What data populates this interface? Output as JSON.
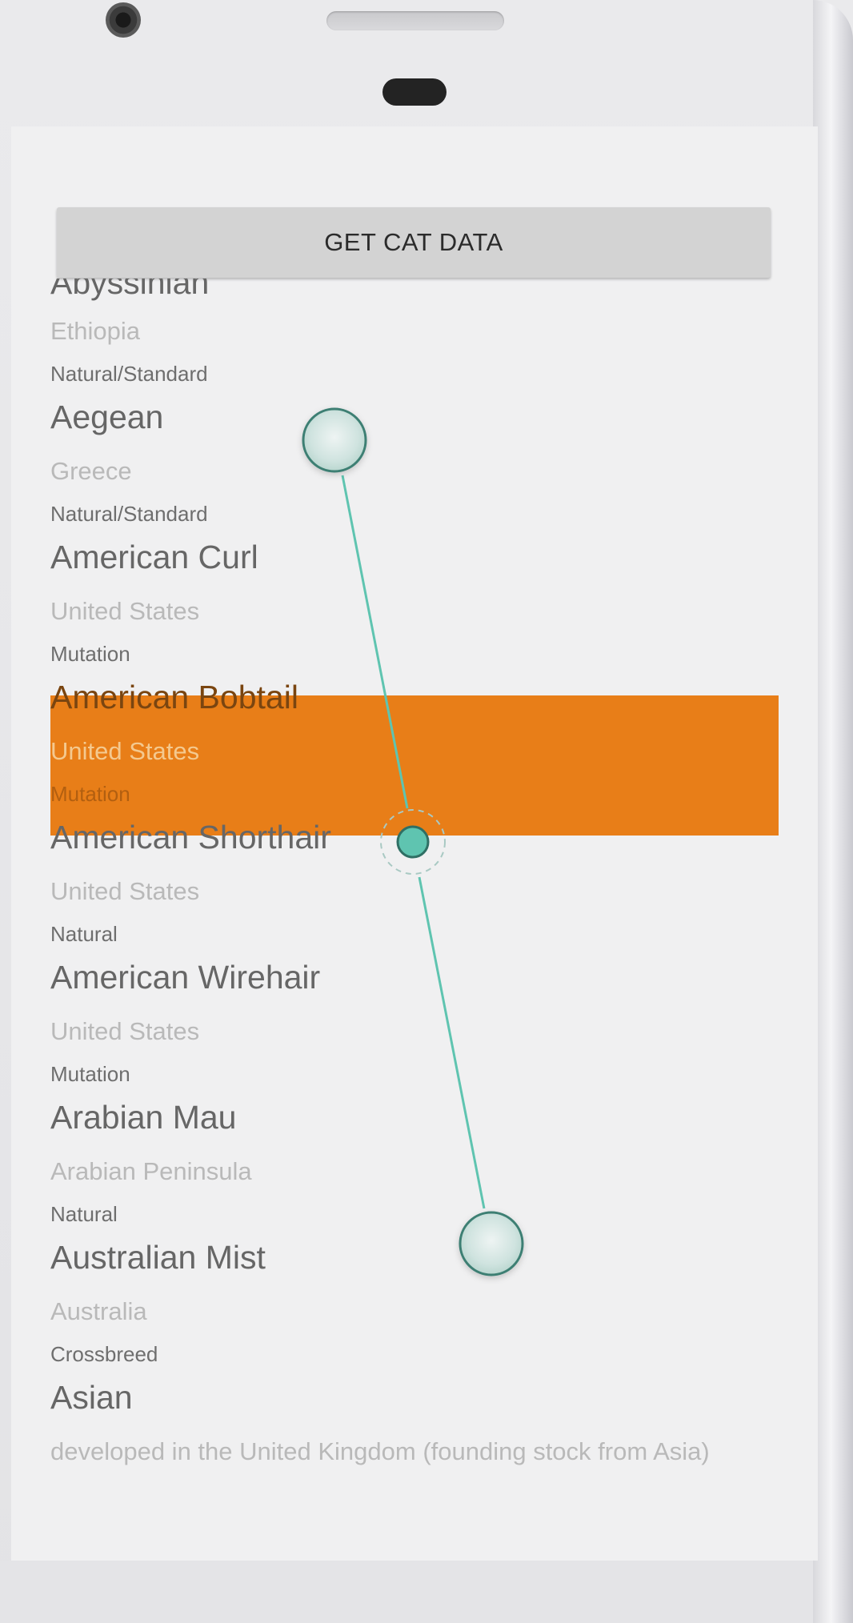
{
  "app": {
    "get_button_label": "GET CAT DATA"
  },
  "list": {
    "partial_top_name": "Abyssinian",
    "items": [
      {
        "origin": "Ethiopia",
        "type": "Natural/Standard"
      },
      {
        "name": "Aegean",
        "origin": "Greece",
        "type": "Natural/Standard"
      },
      {
        "name": "American Curl",
        "origin": "United States",
        "type": "Mutation"
      },
      {
        "name": "American Bobtail",
        "origin": "United States",
        "type": "Mutation"
      },
      {
        "name": "American Shorthair",
        "origin": "United States",
        "type": "Natural"
      },
      {
        "name": "American Wirehair",
        "origin": "United States",
        "type": "Mutation"
      },
      {
        "name": "Arabian Mau",
        "origin": "Arabian Peninsula",
        "type": "Natural"
      },
      {
        "name": "Australian Mist",
        "origin": "Australia",
        "type": "Crossbreed"
      },
      {
        "name": "Asian",
        "origin": "developed in the United Kingdom (founding stock from Asia)"
      }
    ]
  },
  "colors": {
    "highlight": "#e87e18",
    "gesture": "#5fc4b0"
  },
  "gesture": {
    "type": "drag",
    "icons": [
      "touch-start-circle",
      "touch-midpoint-circle",
      "touch-end-circle"
    ]
  }
}
